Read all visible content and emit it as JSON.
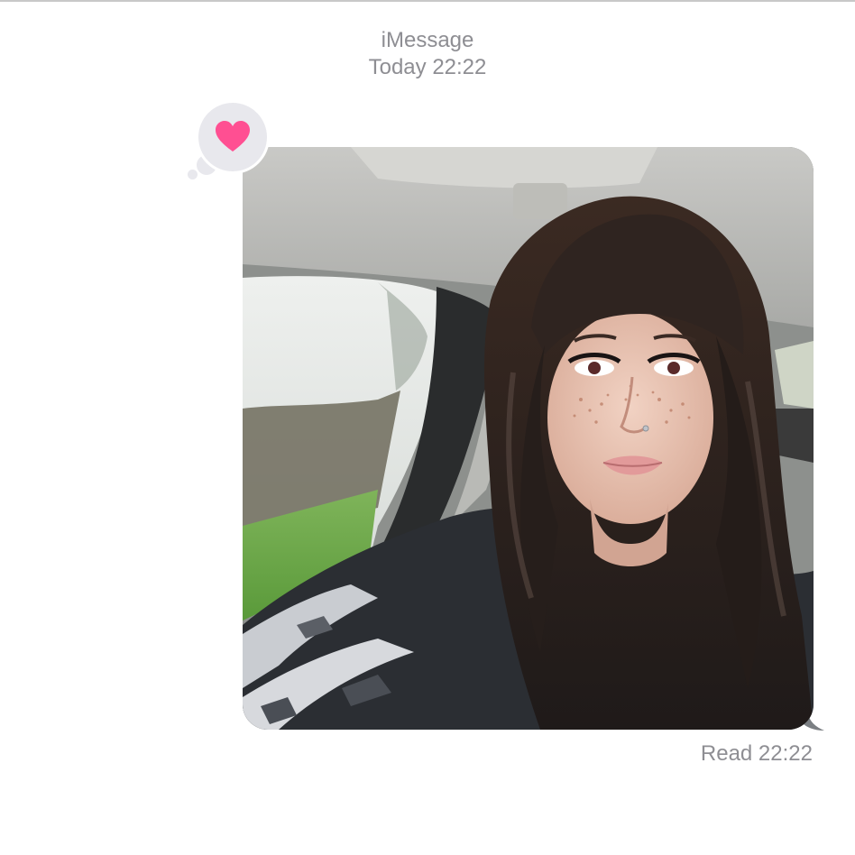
{
  "header": {
    "service": "iMessage",
    "timestamp": "Today 22:22"
  },
  "message": {
    "type": "photo",
    "subject": "selfie-in-car",
    "reaction": {
      "icon": "heart-icon",
      "color": "#ff4f92"
    },
    "read_receipt": "Read 22:22"
  },
  "colors": {
    "meta_text": "#8e8e93",
    "bubble_gray": "#e8e8ed"
  }
}
